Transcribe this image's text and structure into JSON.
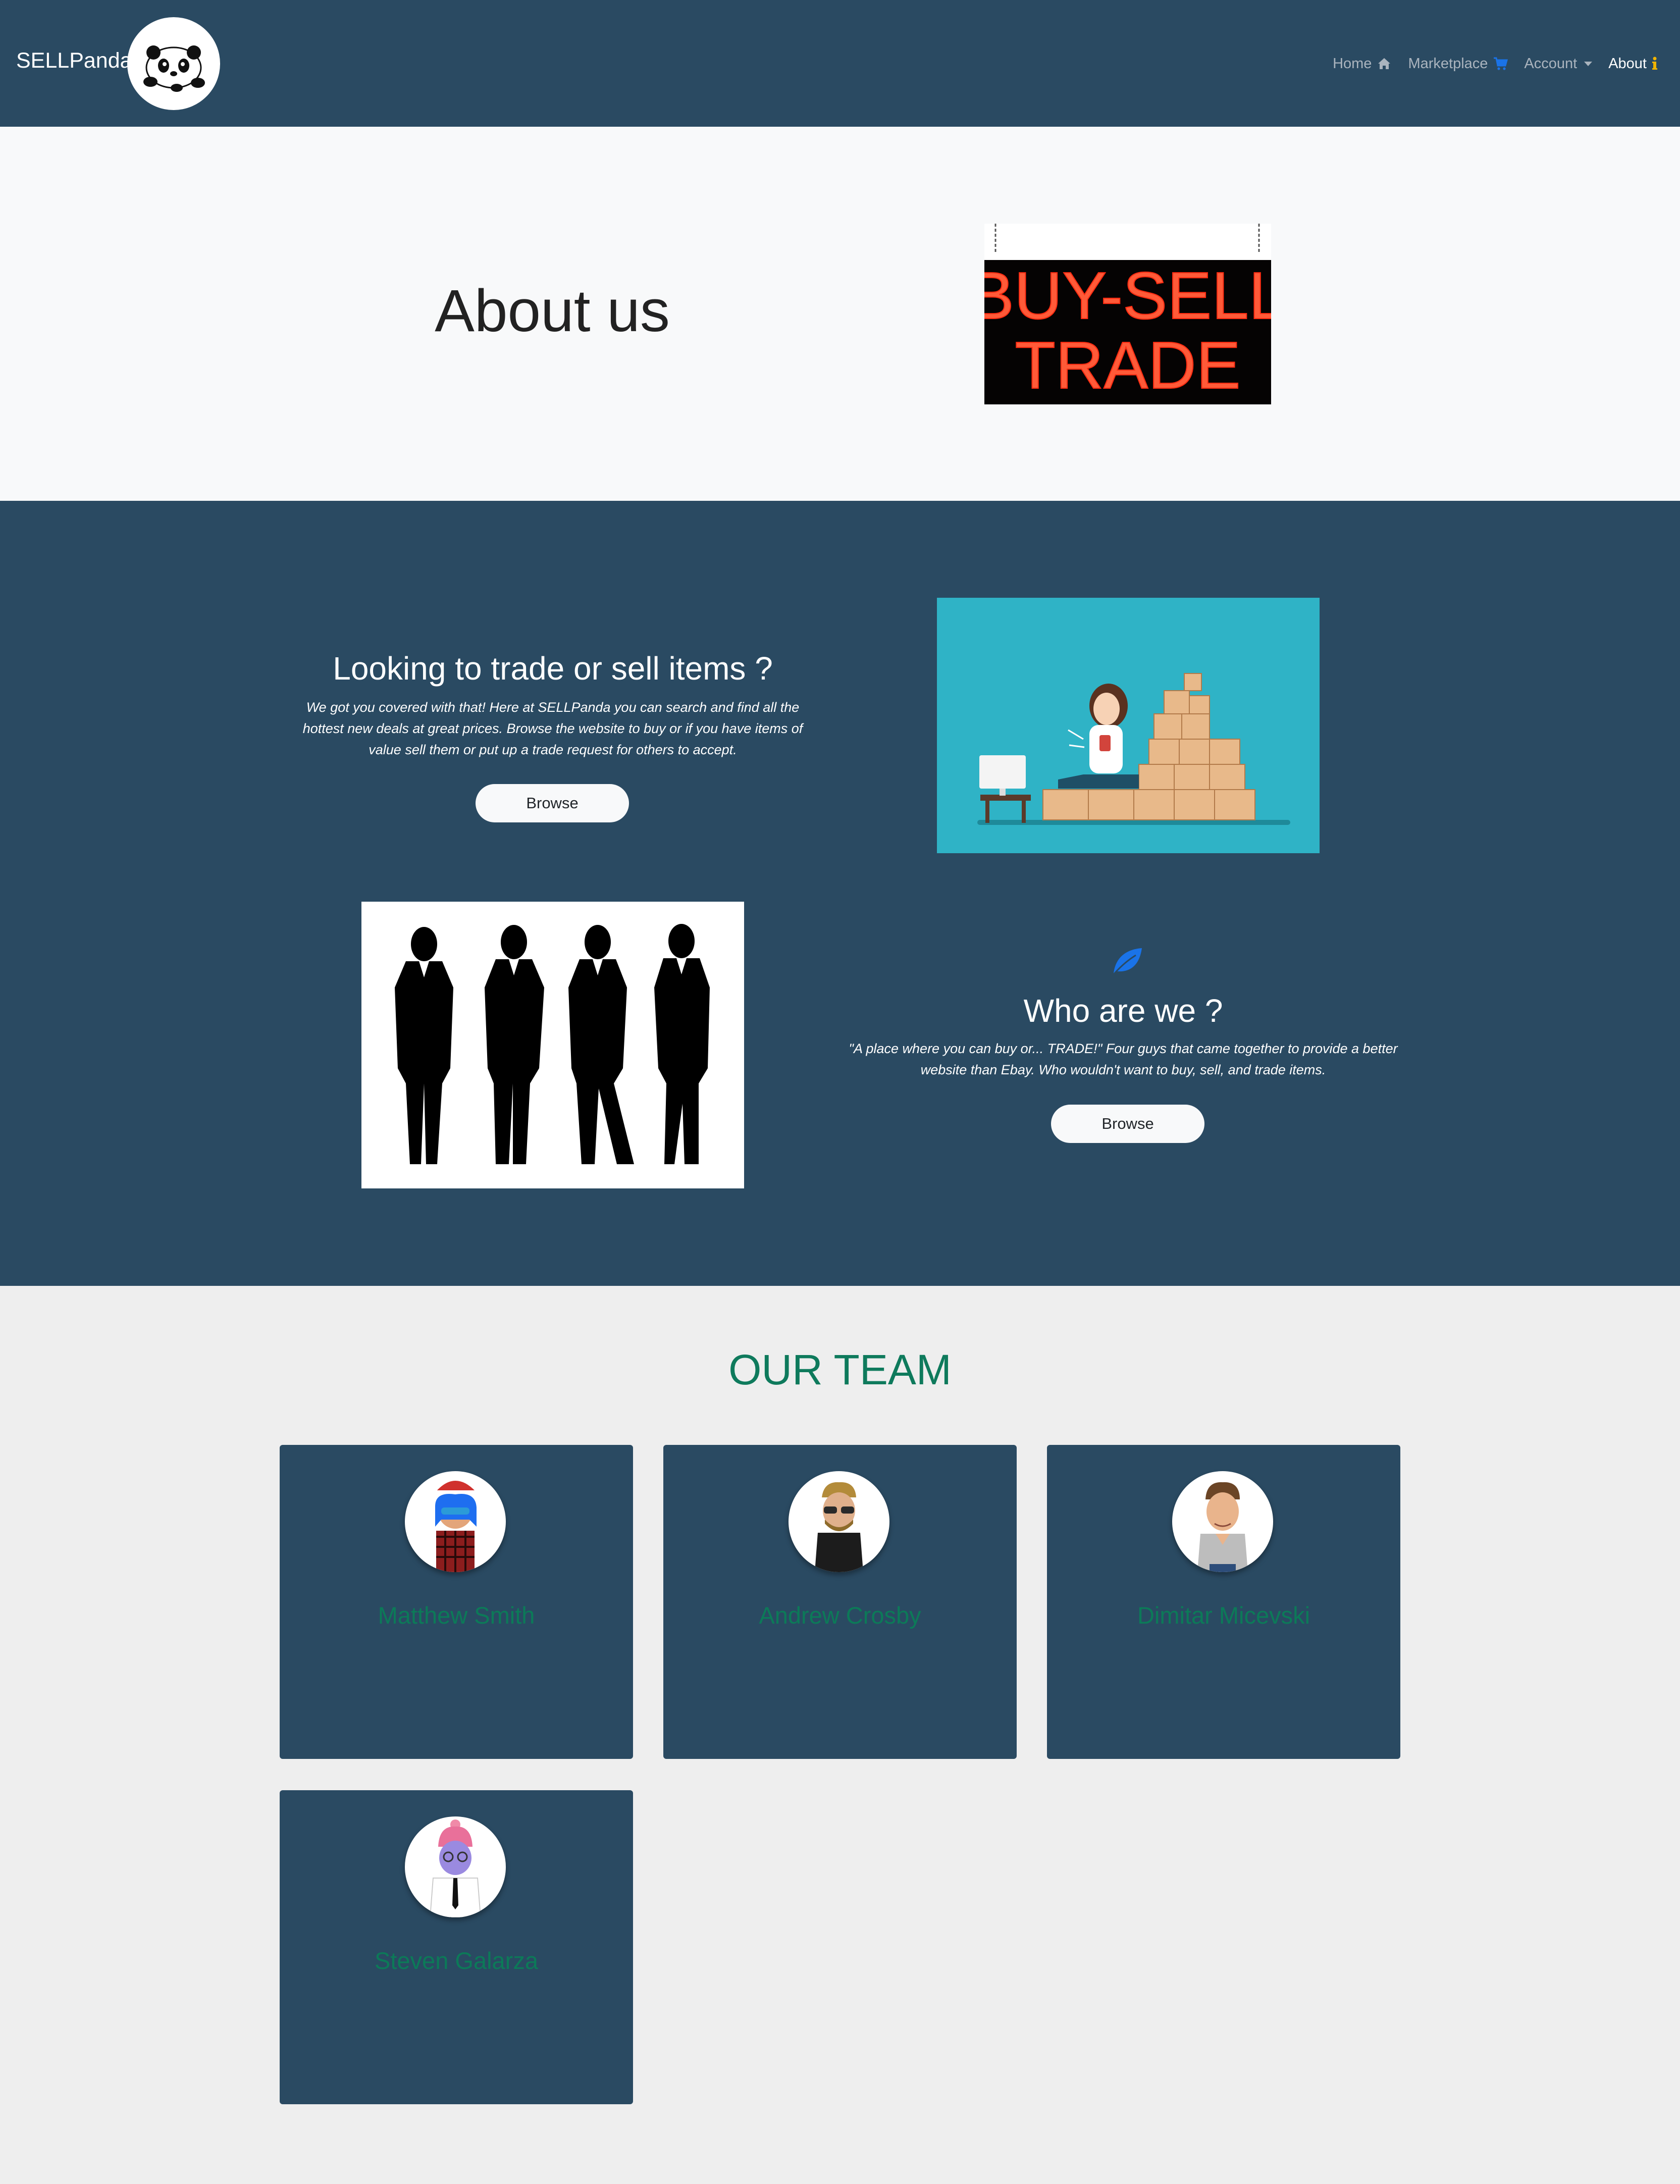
{
  "brand": {
    "name": "SELLPanda"
  },
  "nav": {
    "items": [
      {
        "label": "Home",
        "icon": "home-icon"
      },
      {
        "label": "Marketplace",
        "icon": "cart-icon"
      },
      {
        "label": "Account",
        "icon": "caret-down-icon"
      },
      {
        "label": "About",
        "icon": "info-icon",
        "active": true
      }
    ]
  },
  "hero": {
    "title": "About us",
    "sign_lines": [
      "BUY-SELL",
      "TRADE"
    ]
  },
  "trade": {
    "title": "Looking to trade or sell items ?",
    "text": "We got you covered with that! Here at SELLPanda you can search and find all the hottest new deals at great prices. Browse the website to buy or if you have items of value sell them or put up a trade request for others to accept.",
    "button": "Browse"
  },
  "who": {
    "title": "Who are we ?",
    "text": "\"A place where you can buy or... TRADE!\" Four guys that came together to provide a better website than Ebay. Who wouldn't want to buy, sell, and trade items.",
    "button": "Browse",
    "icon": "leaf-icon"
  },
  "team": {
    "title": "OUR TEAM",
    "members": [
      {
        "name": "Matthew Smith"
      },
      {
        "name": "Andrew Crosby"
      },
      {
        "name": "Dimitar Micevski"
      },
      {
        "name": "Steven Galarza"
      }
    ]
  },
  "colors": {
    "navbar": "#2a4a62",
    "section": "#2a4a62",
    "team_title": "#0e7a5c",
    "member_name": "#0c7a58",
    "accent_icon": "#1a73e8",
    "info_icon": "#f0b400"
  }
}
